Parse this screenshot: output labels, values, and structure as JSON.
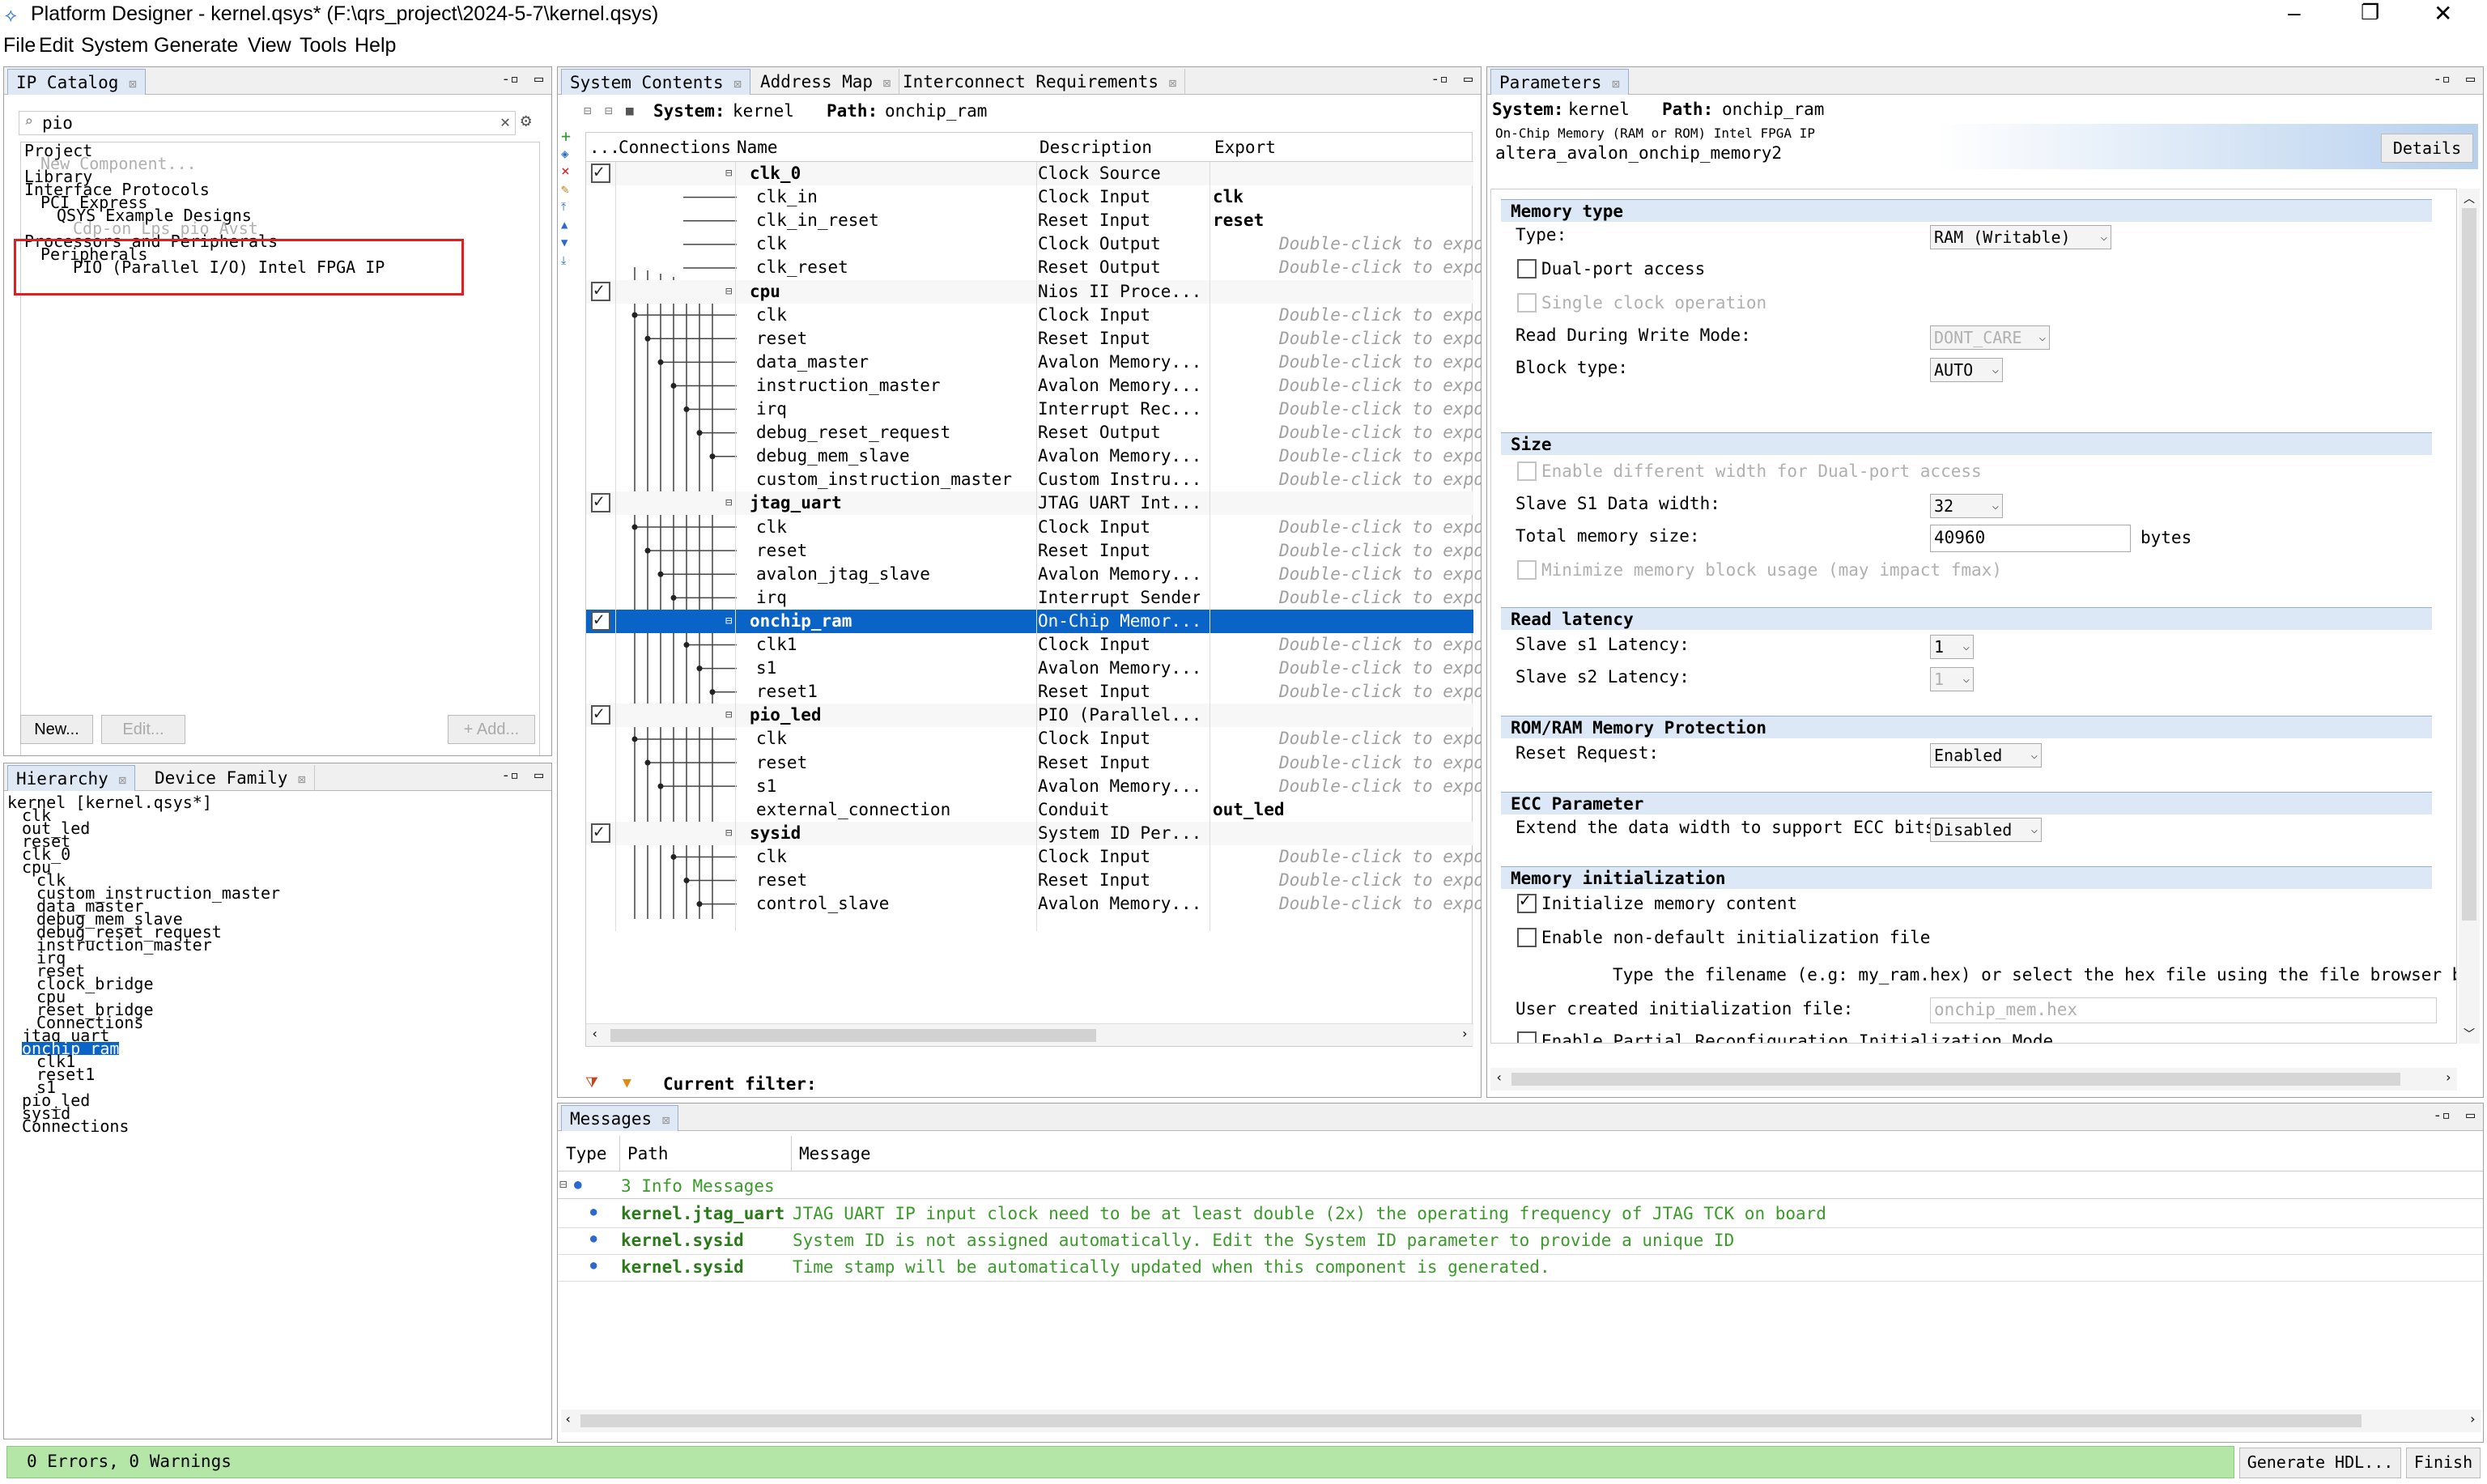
{
  "window": {
    "title": "Platform Designer - kernel.qsys* (F:\\qrs_project\\2024-5-7\\kernel.qsys)"
  },
  "menu": [
    "File",
    "Edit",
    "System",
    "Generate",
    "View",
    "Tools",
    "Help"
  ],
  "ip_catalog": {
    "tab": "IP Catalog",
    "search_value": "pio",
    "tree": [
      {
        "label": "Project",
        "indent": 0,
        "cls": ""
      },
      {
        "label": "New Component...",
        "indent": 1,
        "cls": "dim"
      },
      {
        "label": "Library",
        "indent": 0,
        "cls": ""
      },
      {
        "label": "Interface Protocols",
        "indent": 0,
        "cls": ""
      },
      {
        "label": "PCI Express",
        "indent": 1,
        "cls": ""
      },
      {
        "label": "QSYS Example Designs",
        "indent": 2,
        "cls": ""
      },
      {
        "label": "Cdp-on Lps pio Avst",
        "indent": 3,
        "cls": "dim"
      },
      {
        "label": "Processors and Peripherals",
        "indent": 0,
        "cls": ""
      },
      {
        "label": "Peripherals",
        "indent": 1,
        "cls": ""
      },
      {
        "label": "PIO (Parallel I/O) Intel FPGA IP",
        "indent": 3,
        "cls": ""
      }
    ],
    "buttons": {
      "new": "New...",
      "edit": "Edit...",
      "add": "+ Add..."
    }
  },
  "hierarchy": {
    "tabs": [
      "Hierarchy",
      "Device Family"
    ],
    "items": [
      "kernel [kernel.qsys*]",
      "clk",
      "out_led",
      "reset",
      "clk_0",
      "cpu",
      "clk",
      "custom_instruction_master",
      "data_master",
      "debug_mem_slave",
      "debug_reset_request",
      "instruction_master",
      "irq",
      "reset",
      "clock_bridge",
      "cpu",
      "reset_bridge",
      "Connections",
      "jtag_uart",
      "onchip_ram",
      "clk1",
      "reset1",
      "s1",
      "pio_led",
      "sysid",
      "Connections"
    ]
  },
  "system_contents": {
    "tabs": [
      "System Contents",
      "Address Map",
      "Interconnect Requirements"
    ],
    "system_label": "System:",
    "system_name": "kernel",
    "path_label": "Path:",
    "path_value": "onchip_ram",
    "columns": {
      "use": "...",
      "connections": "Connections",
      "name": "Name",
      "description": "Description",
      "export": "Export"
    },
    "rows": [
      {
        "name": "clk_0",
        "desc": "Clock Source",
        "export": "",
        "component": true,
        "checked": true
      },
      {
        "name": "clk_in",
        "desc": "Clock Input",
        "export": "clk"
      },
      {
        "name": "clk_in_reset",
        "desc": "Reset Input",
        "export": "reset"
      },
      {
        "name": "clk",
        "desc": "Clock Output",
        "export": "Double-click to export"
      },
      {
        "name": "clk_reset",
        "desc": "Reset Output",
        "export": "Double-click to export"
      },
      {
        "name": "cpu",
        "desc": "Nios II Proce...",
        "export": "",
        "component": true,
        "checked": true
      },
      {
        "name": "clk",
        "desc": "Clock Input",
        "export": "Double-click to export"
      },
      {
        "name": "reset",
        "desc": "Reset Input",
        "export": "Double-click to export"
      },
      {
        "name": "data_master",
        "desc": "Avalon Memory...",
        "export": "Double-click to export"
      },
      {
        "name": "instruction_master",
        "desc": "Avalon Memory...",
        "export": "Double-click to export"
      },
      {
        "name": "irq",
        "desc": "Interrupt Rec...",
        "export": "Double-click to export"
      },
      {
        "name": "debug_reset_request",
        "desc": "Reset Output",
        "export": "Double-click to export"
      },
      {
        "name": "debug_mem_slave",
        "desc": "Avalon Memory...",
        "export": "Double-click to export"
      },
      {
        "name": "custom_instruction_master",
        "desc": "Custom Instru...",
        "export": "Double-click to export"
      },
      {
        "name": "jtag_uart",
        "desc": "JTAG UART Int...",
        "export": "",
        "component": true,
        "checked": true
      },
      {
        "name": "clk",
        "desc": "Clock Input",
        "export": "Double-click to export"
      },
      {
        "name": "reset",
        "desc": "Reset Input",
        "export": "Double-click to export"
      },
      {
        "name": "avalon_jtag_slave",
        "desc": "Avalon Memory...",
        "export": "Double-click to export"
      },
      {
        "name": "irq",
        "desc": "Interrupt Sender",
        "export": "Double-click to export"
      },
      {
        "name": "onchip_ram",
        "desc": "On-Chip Memor...",
        "export": "",
        "component": true,
        "checked": true,
        "selected": true
      },
      {
        "name": "clk1",
        "desc": "Clock Input",
        "export": "Double-click to export"
      },
      {
        "name": "s1",
        "desc": "Avalon Memory...",
        "export": "Double-click to export"
      },
      {
        "name": "reset1",
        "desc": "Reset Input",
        "export": "Double-click to export"
      },
      {
        "name": "pio_led",
        "desc": "PIO (Parallel...",
        "export": "",
        "component": true,
        "checked": true
      },
      {
        "name": "clk",
        "desc": "Clock Input",
        "export": "Double-click to export"
      },
      {
        "name": "reset",
        "desc": "Reset Input",
        "export": "Double-click to export"
      },
      {
        "name": "s1",
        "desc": "Avalon Memory...",
        "export": "Double-click to export"
      },
      {
        "name": "external_connection",
        "desc": "Conduit",
        "export": "out_led"
      },
      {
        "name": "sysid",
        "desc": "System ID Per...",
        "export": "",
        "component": true,
        "checked": true
      },
      {
        "name": "clk",
        "desc": "Clock Input",
        "export": "Double-click to export"
      },
      {
        "name": "reset",
        "desc": "Reset Input",
        "export": "Double-click to export"
      },
      {
        "name": "control_slave",
        "desc": "Avalon Memory...",
        "export": "Double-click to export"
      }
    ],
    "filter_label": "Current filter:"
  },
  "parameters": {
    "tab": "Parameters",
    "system_label": "System:",
    "system_name": "kernel",
    "path_label": "Path:",
    "path_value": "onchip_ram",
    "ip_line": "On-Chip Memory (RAM or ROM) Intel FPGA IP",
    "ip_name": "altera_avalon_onchip_memory2",
    "details_button": "Details",
    "memory_type": {
      "title": "Memory type",
      "type_label": "Type:",
      "type_value": "RAM (Writable)",
      "dual_port": "Dual-port access",
      "single_clock": "Single clock operation",
      "rdw_label": "Read During Write Mode:",
      "rdw_value": "DONT_CARE",
      "block_label": "Block type:",
      "block_value": "AUTO"
    },
    "size": {
      "title": "Size",
      "diff_width": "Enable different width for Dual-port access",
      "s1_width_label": "Slave S1 Data width:",
      "s1_width_value": "32",
      "total_label": "Total memory size:",
      "total_value": "40960",
      "total_unit": "bytes",
      "minimize": "Minimize memory block usage (may impact fmax)"
    },
    "read_latency": {
      "title": "Read latency",
      "s1_label": "Slave s1 Latency:",
      "s1_value": "1",
      "s2_label": "Slave s2 Latency:",
      "s2_value": "1"
    },
    "protection": {
      "title": "ROM/RAM Memory Protection",
      "reset_label": "Reset Request:",
      "reset_value": "Enabled"
    },
    "ecc": {
      "title": "ECC Parameter",
      "extend_label": "Extend the data width to support ECC bits:",
      "extend_value": "Disabled"
    },
    "init": {
      "title": "Memory initialization",
      "init_content": "Initialize memory content",
      "non_default": "Enable non-default initialization file",
      "hint": "Type the filename (e.g: my_ram.hex) or select the hex file using the file browser butto",
      "file_label": "User created initialization file:",
      "file_value": "onchip_mem.hex",
      "partial": "Enable Partial Reconfiguration Initialization Mode"
    }
  },
  "messages": {
    "tab": "Messages",
    "columns": {
      "type": "Type",
      "path": "Path",
      "message": "Message"
    },
    "group": "3 Info Messages",
    "items": [
      {
        "path": "kernel.jtag_uart",
        "text": "JTAG UART IP input clock need to be at least double (2x) the operating frequency of JTAG TCK on board"
      },
      {
        "path": "kernel.sysid",
        "text": "System ID is not assigned automatically. Edit the System ID parameter to provide a unique ID"
      },
      {
        "path": "kernel.sysid",
        "text": "Time stamp will be automatically updated when this component is generated."
      }
    ]
  },
  "statusbar": {
    "text": "0 Errors, 0 Warnings",
    "generate_button": "Generate HDL...",
    "finish_button": "Finish"
  },
  "colors": {
    "accent": "#0a64c8",
    "status_green": "#b4e6a8",
    "msg_green": "#3a9a2a",
    "path_green": "#2a7a1a",
    "highlight_red": "#e02020"
  }
}
